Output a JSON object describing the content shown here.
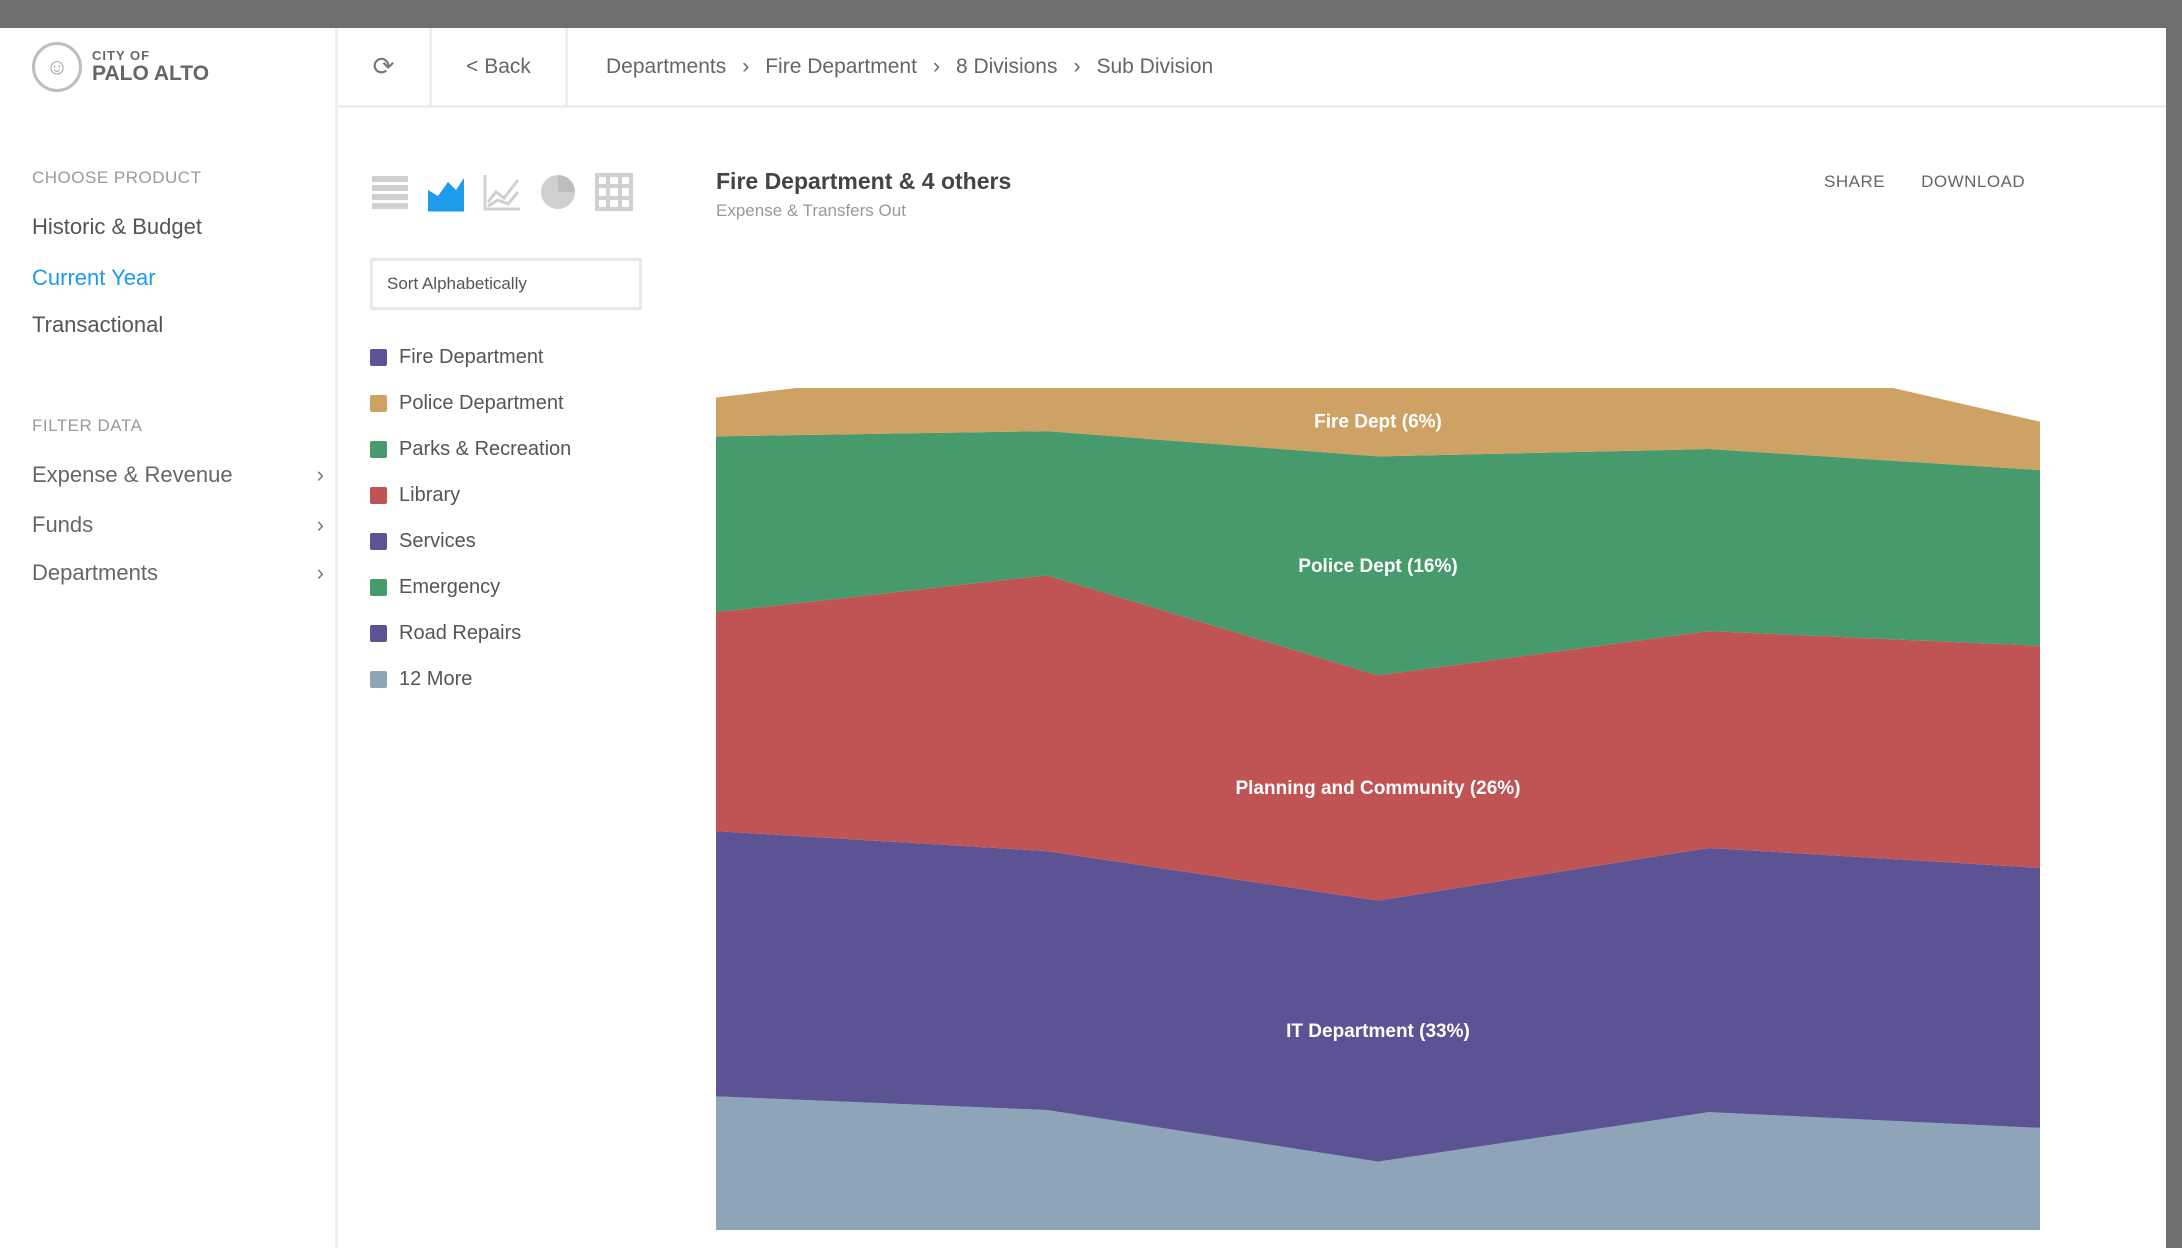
{
  "logo": {
    "small": "CITY OF",
    "large": "PALO ALTO"
  },
  "sidebar": {
    "choose_title": "CHOOSE PRODUCT",
    "products": [
      {
        "label": "Historic & Budget",
        "active": false
      },
      {
        "label": "Current Year",
        "active": true
      },
      {
        "label": "Transactional",
        "active": false
      }
    ],
    "filter_title": "FILTER DATA",
    "filters": [
      {
        "label": "Expense & Revenue"
      },
      {
        "label": "Funds"
      },
      {
        "label": "Departments"
      }
    ]
  },
  "toolbar": {
    "back_label": "< Back",
    "breadcrumb": [
      "Departments",
      "Fire Department",
      "8 Divisions",
      "Sub Division"
    ]
  },
  "chart_types": [
    "table-icon",
    "area-chart-icon",
    "line-chart-icon",
    "pie-chart-icon",
    "grid-icon"
  ],
  "sort_label": "Sort Alphabetically",
  "legend": [
    {
      "label": "Fire Department",
      "color": "#5b5394"
    },
    {
      "label": "Police Department",
      "color": "#cea265"
    },
    {
      "label": "Parks & Recreation",
      "color": "#479a6c"
    },
    {
      "label": "Library",
      "color": "#c05353"
    },
    {
      "label": "Services",
      "color": "#5b5394"
    },
    {
      "label": "Emergency",
      "color": "#479a6c"
    },
    {
      "label": "Road Repairs",
      "color": "#5b5394"
    },
    {
      "label": "12 More",
      "color": "#8ea4b8"
    }
  ],
  "chart_header": {
    "title": "Fire Department & 4 others",
    "subtitle": "Expense & Transfers Out",
    "share_label": "SHARE",
    "download_label": "DOWNLOAD"
  },
  "chart_data": {
    "type": "area",
    "stacked": true,
    "x_points": 5,
    "series": [
      {
        "name": "",
        "color": "#8ea4b8",
        "values": [
          127,
          114,
          65,
          112,
          97
        ]
      },
      {
        "name": "IT Department (33%)",
        "color": "#5b5394",
        "values": [
          252,
          246,
          248,
          251,
          247
        ]
      },
      {
        "name": "Planning and Community (26%)",
        "color": "#c05353",
        "values": [
          208,
          262,
          214,
          206,
          211
        ]
      },
      {
        "name": "Police Dept (16%)",
        "color": "#479a6c",
        "values": [
          167,
          137,
          208,
          173,
          167
        ]
      },
      {
        "name": "Fire Dept (6%)",
        "color": "#cea265",
        "values": [
          37,
          69,
          66,
          98,
          46
        ]
      }
    ],
    "labels": [
      "IT Department (33%)",
      "Planning and Community (26%)",
      "Police Dept (16%)",
      "Fire Dept (6%)"
    ],
    "ylim": [
      0,
      800
    ],
    "grid": false
  }
}
